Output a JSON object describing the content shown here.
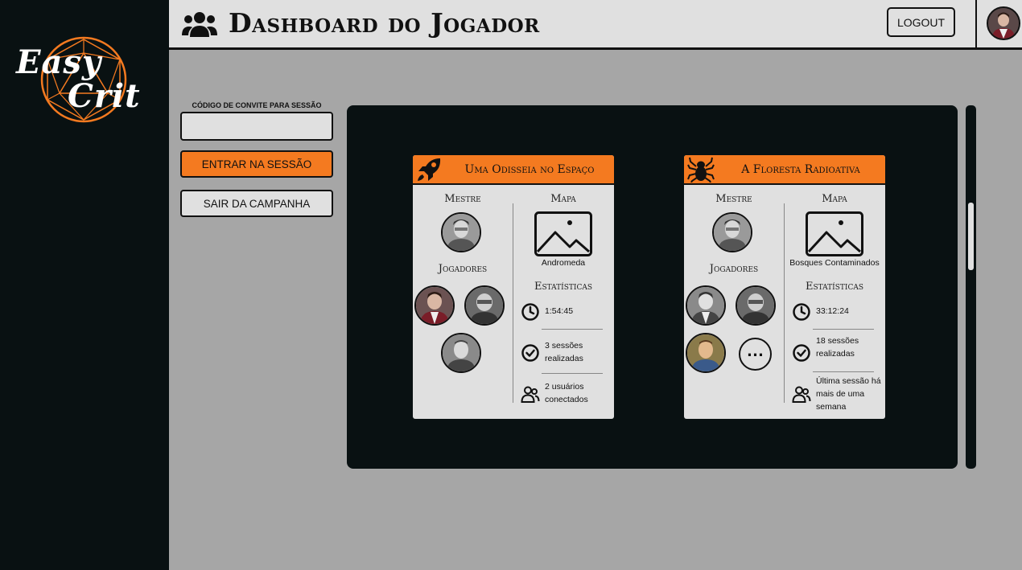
{
  "app": {
    "logo_line1": "Easy",
    "logo_line2": "Crit",
    "accent": "#f47a20",
    "dark": "#091112"
  },
  "header": {
    "title": "Dashboard do Jogador",
    "icon": "users-icon",
    "logout_label": "LOGOUT"
  },
  "session": {
    "invite_label": "CÓDIGO DE CONVITE PARA SESSÃO",
    "invite_value": "",
    "invite_placeholder": "",
    "enter_label": "ENTRAR NA SESSÃO",
    "leave_label": "SAIR DA CAMPANHA"
  },
  "labels": {
    "master": "Mestre",
    "players": "Jogadores",
    "map": "Mapa",
    "stats": "Estatísticas"
  },
  "campaigns": [
    {
      "title": "Uma Odisseia no Espaço",
      "icon": "rocket-icon",
      "map_name": "Andromeda",
      "time": "1:54:45",
      "sessions": "3 sessões realizadas",
      "status": "2 usuários conectados"
    },
    {
      "title": "A Floresta Radioativa",
      "icon": "spider-icon",
      "map_name": "Bosques Contaminados",
      "time": "33:12:24",
      "sessions": "18 sessões realizadas",
      "status": "Última sessão há mais de uma semana"
    }
  ]
}
